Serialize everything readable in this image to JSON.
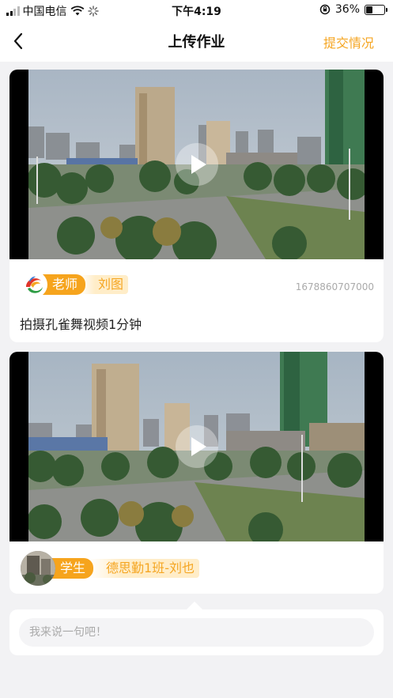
{
  "status_bar": {
    "carrier": "中国电信",
    "time": "下午4:19",
    "battery": "36%",
    "battery_level": 0.36,
    "icons": [
      "signal-icon",
      "wifi-icon",
      "loading-icon",
      "orientation-lock-icon",
      "battery-icon"
    ]
  },
  "nav": {
    "title": "上传作业",
    "right_action": "提交情况",
    "back_icon": "chevron-left-icon"
  },
  "posts": [
    {
      "role": "老师",
      "name": "刘图",
      "timestamp": "1678860707000",
      "caption": "拍摄孔雀舞视频1分钟",
      "avatar": "school-logo"
    },
    {
      "role": "学生",
      "name": "德思勤1班-刘也",
      "avatar": "photo"
    }
  ],
  "comment": {
    "placeholder": "我来说一句吧！"
  },
  "colors": {
    "accent": "#f5a623",
    "badge": "#f6a41d",
    "name_bg": "#ffedc8",
    "page_bg": "#f2f2f4"
  }
}
